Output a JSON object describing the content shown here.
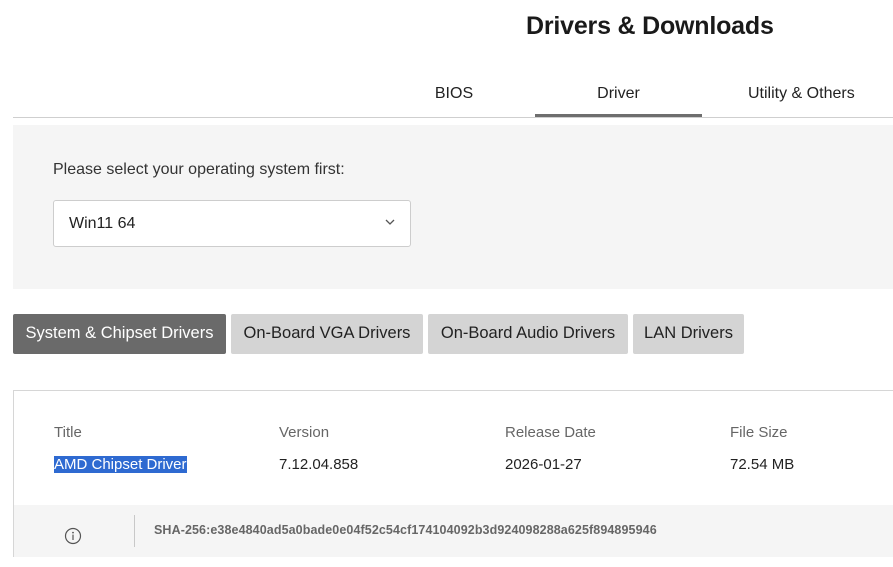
{
  "page": {
    "title": "Drivers & Downloads"
  },
  "tabs": [
    {
      "label": "BIOS",
      "active": false
    },
    {
      "label": "Driver",
      "active": true
    },
    {
      "label": "Utility & Others",
      "active": false
    }
  ],
  "os_selector": {
    "label": "Please select your operating system first:",
    "value": "Win11 64",
    "icon": "chevron-down-icon"
  },
  "categories": [
    {
      "label": "System & Chipset Drivers",
      "active": true
    },
    {
      "label": "On-Board VGA Drivers",
      "active": false
    },
    {
      "label": "On-Board Audio Drivers",
      "active": false
    },
    {
      "label": "LAN Drivers",
      "active": false
    }
  ],
  "driver_table": {
    "columns": [
      "Title",
      "Version",
      "Release Date",
      "File Size"
    ],
    "rows": [
      {
        "title": "AMD Chipset Driver",
        "version": "7.12.04.858",
        "release_date": "2026-01-27",
        "file_size": "72.54 MB",
        "sha": "SHA-256:e38e4840ad5a0bade0e04f52c54cf174104092b3d924098288a625f894895946",
        "info_icon": "info-icon"
      }
    ]
  },
  "colors": {
    "active_tab_underline": "#6e6e6e",
    "active_category_bg": "#6a6a6a",
    "inactive_category_bg": "#d4d4d4",
    "selection_highlight": "#2e6ad1",
    "panel_bg": "#f5f5f5"
  }
}
